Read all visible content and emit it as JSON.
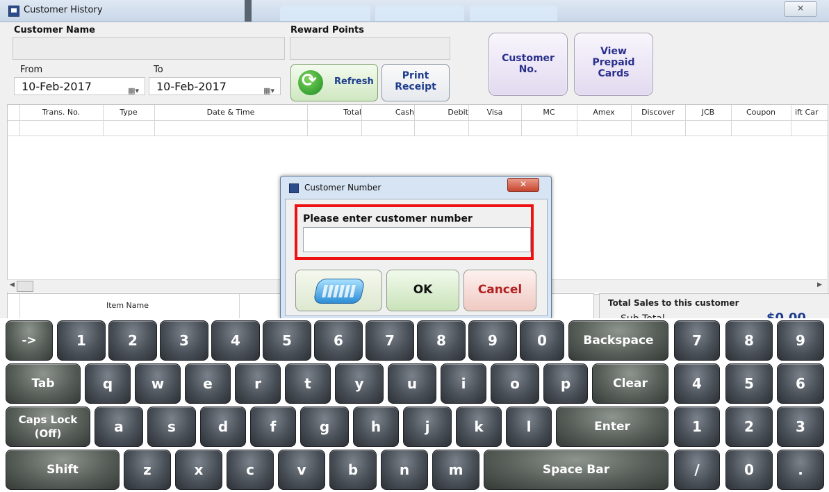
{
  "window": {
    "title": "Customer History",
    "close_label": "✕"
  },
  "filters": {
    "customer_name_label": "Customer Name",
    "customer_name_value": "",
    "reward_points_label": "Reward Points",
    "reward_points_value": "",
    "from_label": "From",
    "from_date": "10-Feb-2017",
    "to_label": "To",
    "to_date": "10-Feb-2017"
  },
  "buttons": {
    "refresh": "Refresh",
    "print_receipt": [
      "Print",
      "Receipt"
    ],
    "customer_no": [
      "Customer",
      "No."
    ],
    "view_prepaid": [
      "View",
      "Prepaid",
      "Cards"
    ]
  },
  "grid": {
    "columns": [
      "Trans. No.",
      "Type",
      "Date & Time",
      "Total",
      "Cash",
      "Debit",
      "Visa",
      "MC",
      "Amex",
      "Discover",
      "JCB",
      "Coupon",
      "ift Car"
    ]
  },
  "items_grid": {
    "columns": [
      "Item Name"
    ]
  },
  "totals": {
    "heading": "Total Sales to this customer",
    "subtotal_label": "Sub Total",
    "subtotal_value": "$0.00"
  },
  "dialog": {
    "title": "Customer Number",
    "close_label": "✕",
    "prompt": "Please enter customer number",
    "input_value": "",
    "ok": "OK",
    "cancel": "Cancel"
  },
  "keyboard": {
    "row1": [
      "->",
      "1",
      "2",
      "3",
      "4",
      "5",
      "6",
      "7",
      "8",
      "9",
      "0",
      "Backspace"
    ],
    "row2": [
      "Tab",
      "q",
      "w",
      "e",
      "r",
      "t",
      "y",
      "u",
      "i",
      "o",
      "p",
      "Clear"
    ],
    "row3_caps": [
      "Caps Lock",
      "(Off)"
    ],
    "row3": [
      "a",
      "s",
      "d",
      "f",
      "g",
      "h",
      "j",
      "k",
      "l",
      "Enter"
    ],
    "row4": [
      "Shift",
      "z",
      "x",
      "c",
      "v",
      "b",
      "n",
      "m",
      "Space Bar"
    ],
    "numpad": [
      "7",
      "8",
      "9",
      "4",
      "5",
      "6",
      "1",
      "2",
      "3",
      "/",
      "0",
      "."
    ]
  },
  "colors": {
    "accent": "#1d3d8c",
    "highlight": "#e11111",
    "cancel_text": "#b22222"
  }
}
